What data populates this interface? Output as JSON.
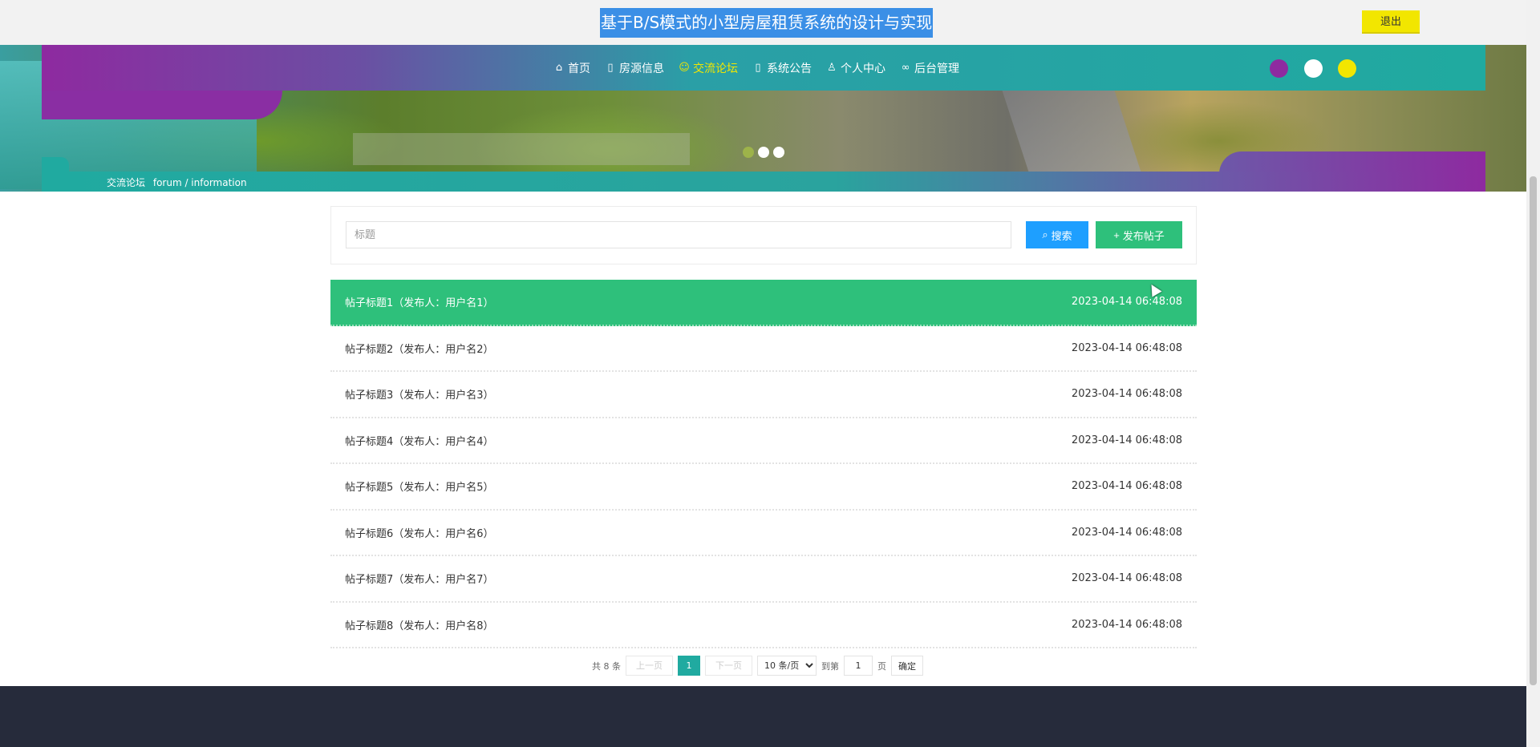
{
  "header": {
    "site_title": "基于B/S模式的小型房屋租赁系统的设计与实现",
    "logout_label": "退出"
  },
  "nav": {
    "items": [
      {
        "label": "首页",
        "icon": "home-icon"
      },
      {
        "label": "房源信息",
        "icon": "document-icon"
      },
      {
        "label": "交流论坛",
        "icon": "chat-icon",
        "active": true
      },
      {
        "label": "系统公告",
        "icon": "book-icon"
      },
      {
        "label": "个人中心",
        "icon": "user-icon"
      },
      {
        "label": "后台管理",
        "icon": "link-icon"
      }
    ],
    "theme_colors": [
      "#8e2aa0",
      "#ffffff",
      "#f2e600"
    ]
  },
  "breadcrumb": {
    "title": "交流论坛",
    "subtitle": "forum / information"
  },
  "search": {
    "placeholder": "标题",
    "search_label": "搜索",
    "post_label": "发布帖子"
  },
  "posts": [
    {
      "title": "帖子标题1（发布人：用户名1）",
      "time": "2023-04-14 06:48:08"
    },
    {
      "title": "帖子标题2（发布人：用户名2）",
      "time": "2023-04-14 06:48:08"
    },
    {
      "title": "帖子标题3（发布人：用户名3）",
      "time": "2023-04-14 06:48:08"
    },
    {
      "title": "帖子标题4（发布人：用户名4）",
      "time": "2023-04-14 06:48:08"
    },
    {
      "title": "帖子标题5（发布人：用户名5）",
      "time": "2023-04-14 06:48:08"
    },
    {
      "title": "帖子标题6（发布人：用户名6）",
      "time": "2023-04-14 06:48:08"
    },
    {
      "title": "帖子标题7（发布人：用户名7）",
      "time": "2023-04-14 06:48:08"
    },
    {
      "title": "帖子标题8（发布人：用户名8）",
      "time": "2023-04-14 06:48:08"
    }
  ],
  "pagination": {
    "total": "共 8 条",
    "prev": "上一页",
    "current": "1",
    "next": "下一页",
    "page_size": "10 条/页",
    "goto": "到第",
    "goto_value": "1",
    "page_unit": "页",
    "confirm": "确定"
  },
  "colors": {
    "primary": "#20aaa0",
    "accent_yellow": "#f2e600",
    "accent_purple": "#8e2aa0",
    "success": "#2ec07b",
    "info": "#1e9fff",
    "footer": "#262b3b"
  }
}
